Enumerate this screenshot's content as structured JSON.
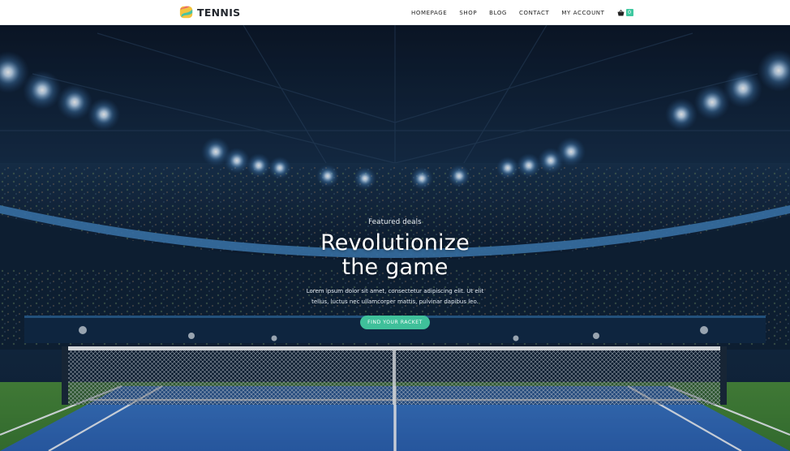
{
  "brand": {
    "name": "TENNIS",
    "logo_icon": "tennis-ball-logo-icon"
  },
  "nav": {
    "items": [
      "HOMEPAGE",
      "SHOP",
      "BLOG",
      "CONTACT",
      "MY ACCOUNT"
    ],
    "cart": {
      "icon": "basket-icon",
      "count": "0"
    }
  },
  "hero": {
    "eyebrow": "Featured deals",
    "title_line1": "Revolutionize",
    "title_line2": "the game",
    "text": "Lorem ipsum dolor sit amet, consectetur adipiscing elit. Ut elit tellus, luctus nec ullamcorper mattis, pulvinar dapibus leo.",
    "cta": "FIND YOUR RACKET"
  },
  "colors": {
    "accent": "#3fc09a",
    "header_bg": "#ffffff",
    "court_blue": "#2f6fc7",
    "court_green": "#3f8a3a"
  }
}
